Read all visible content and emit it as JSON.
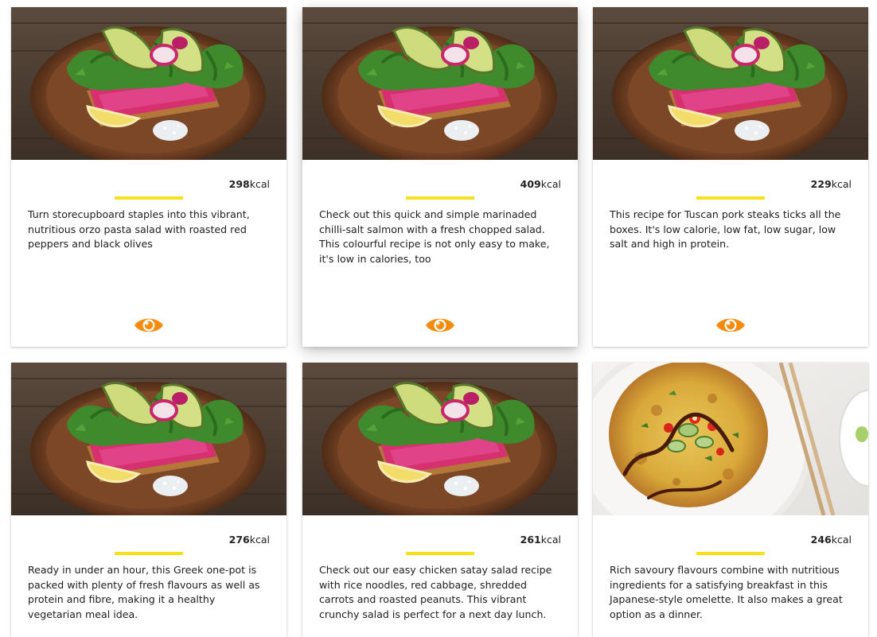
{
  "accent_eye_color": "#f68a0a",
  "accent_divider_color": "#f7e11c",
  "cards": [
    {
      "image": "avocado-beetroot-toast-photo",
      "kcal_value": "298",
      "kcal_unit": "kcal",
      "description": "Turn storecupboard staples into this vibrant, nutritious orzo pasta salad with roasted red peppers and black olives",
      "action_icon": "eye-icon"
    },
    {
      "image": "avocado-beetroot-toast-photo",
      "kcal_value": "409",
      "kcal_unit": "kcal",
      "description": "Check out this quick and simple marinaded chilli-salt salmon with a fresh chopped salad. This colourful recipe is not only easy to make, it's low in calories, too",
      "action_icon": "eye-icon"
    },
    {
      "image": "avocado-beetroot-toast-photo",
      "kcal_value": "229",
      "kcal_unit": "kcal",
      "description": "This recipe for Tuscan pork steaks ticks all the boxes. It's low calorie, low fat, low sugar, low salt and high in protein.",
      "action_icon": "eye-icon"
    },
    {
      "image": "avocado-beetroot-toast-photo",
      "kcal_value": "276",
      "kcal_unit": "kcal",
      "description": "Ready in under an hour, this Greek one-pot is packed with plenty of fresh flavours as well as protein and fibre, making it a healthy vegetarian meal idea.",
      "action_icon": "eye-icon"
    },
    {
      "image": "avocado-beetroot-toast-photo",
      "kcal_value": "261",
      "kcal_unit": "kcal",
      "description": "Check out our easy chicken satay salad recipe with rice noodles, red cabbage, shredded carrots and roasted peanuts. This vibrant crunchy salad is perfect for a next day lunch.",
      "action_icon": "eye-icon"
    },
    {
      "image": "japanese-omelette-photo",
      "kcal_value": "246",
      "kcal_unit": "kcal",
      "description": "Rich savoury flavours combine with nutritious ingredients for a satisfying breakfast in this Japanese-style omelette. It also makes a great option as a dinner.",
      "action_icon": "eye-icon"
    }
  ]
}
